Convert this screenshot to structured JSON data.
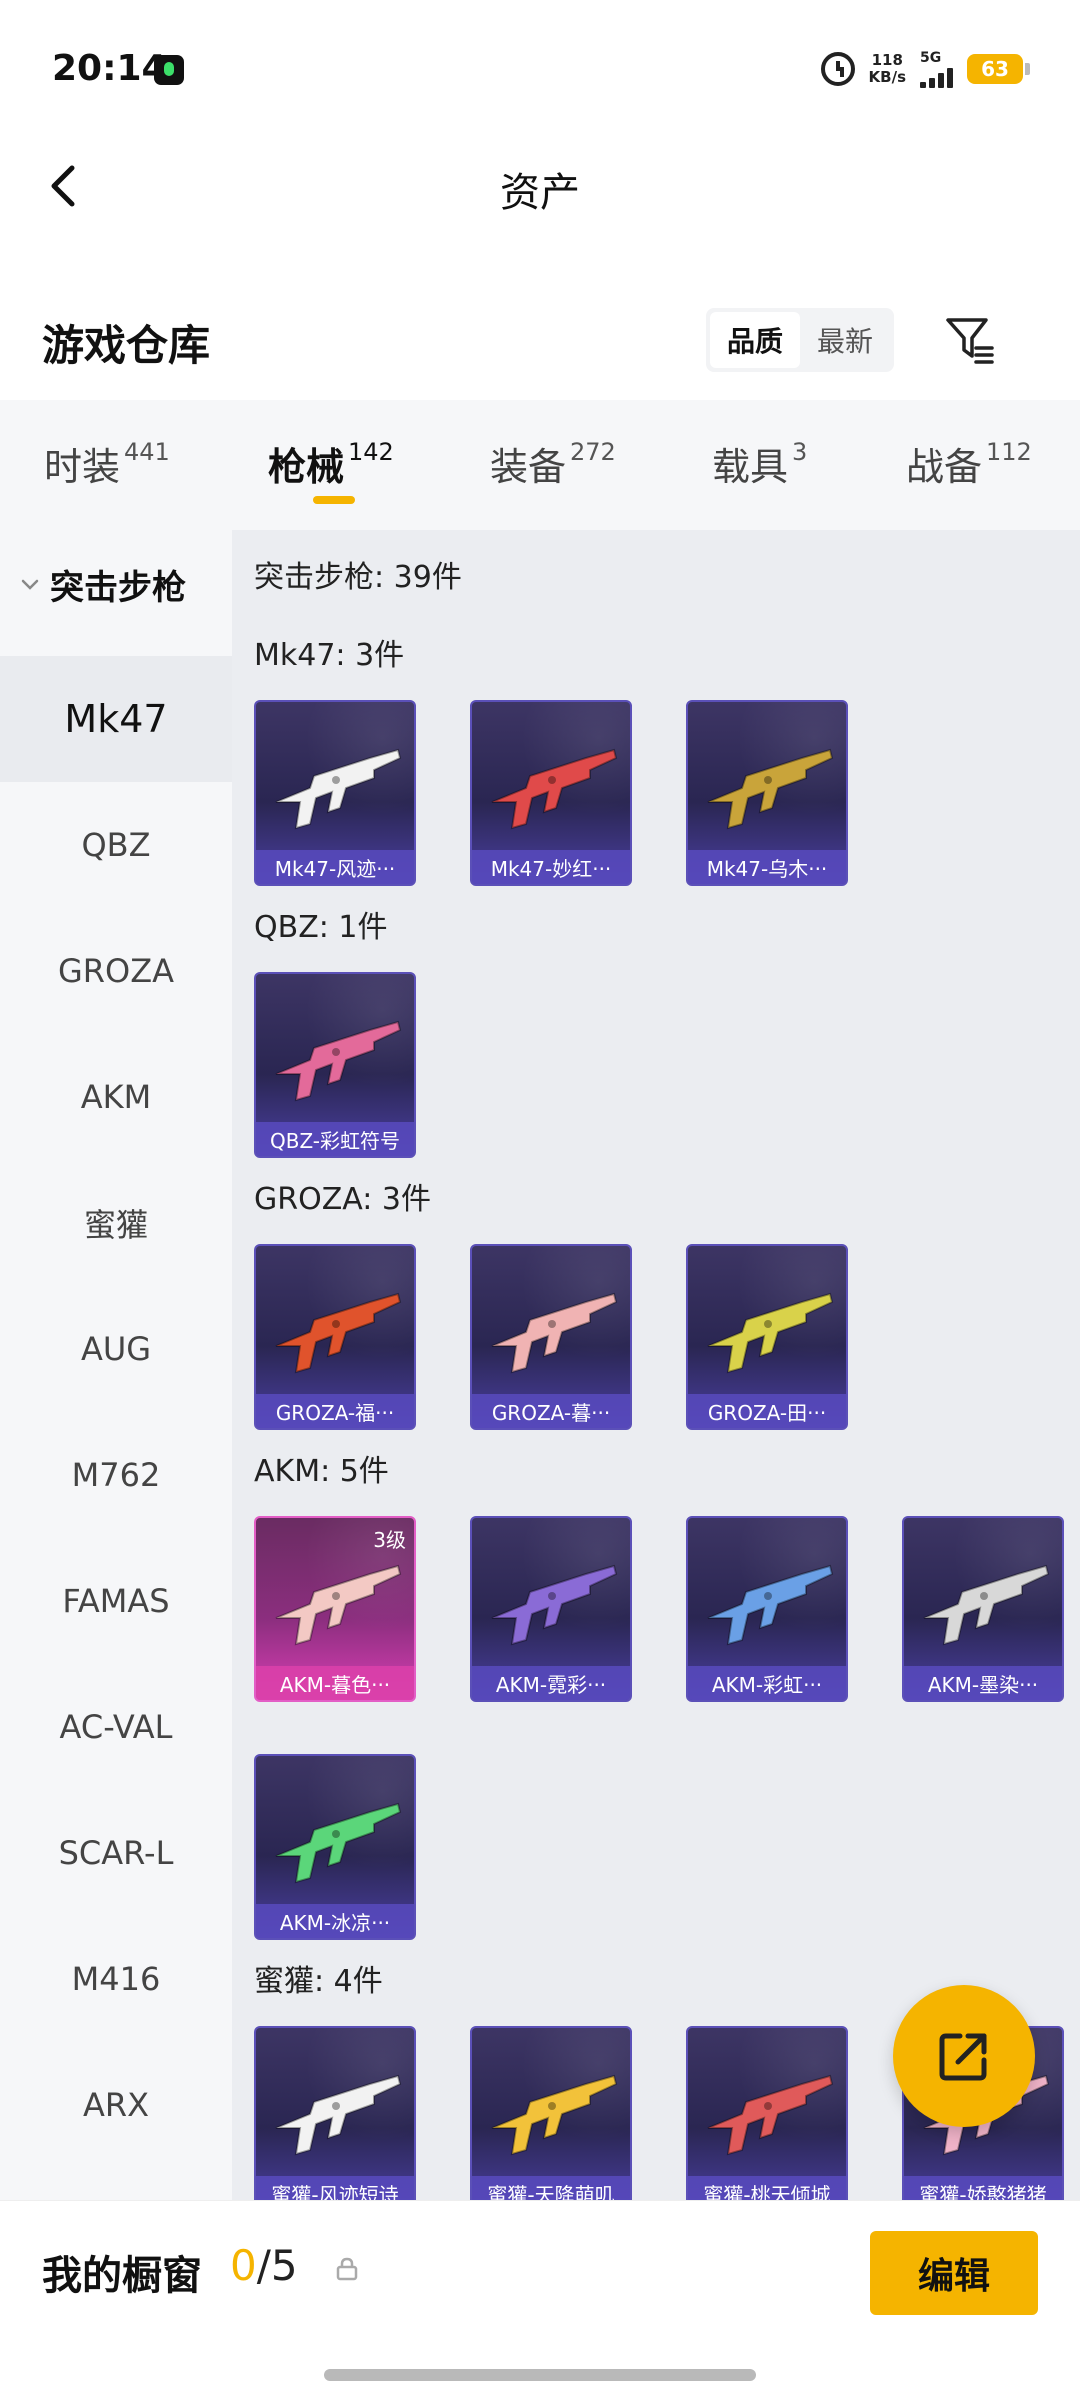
{
  "status_bar": {
    "time": "20:14",
    "net_speed_value": "118",
    "net_speed_unit": "KB/s",
    "network": "5G",
    "battery": "63"
  },
  "header": {
    "title": "资产",
    "back_icon": "chevron-left-icon"
  },
  "warehouse": {
    "title": "游戏仓库",
    "sort_options": [
      "品质",
      "最新"
    ],
    "sort_active": "品质",
    "filter_icon": "filter-icon"
  },
  "categories": [
    {
      "label": "时装",
      "count": "441"
    },
    {
      "label": "枪械",
      "count": "142",
      "active": true
    },
    {
      "label": "装备",
      "count": "272"
    },
    {
      "label": "载具",
      "count": "3"
    },
    {
      "label": "战备",
      "count": "112"
    }
  ],
  "sidebar": {
    "group_label": "突击步枪",
    "items": [
      "Mk47",
      "QBZ",
      "GROZA",
      "AKM",
      "蜜獾",
      "AUG",
      "M762",
      "FAMAS",
      "AC-VAL",
      "SCAR-L",
      "M416",
      "ARX"
    ],
    "active_item": "Mk47"
  },
  "content": {
    "group_summary": "突击步枪: 39件",
    "sections": [
      {
        "header": "Mk47: 3件",
        "cards": [
          {
            "label": "Mk47-风迹···",
            "color": "#f2f2f2"
          },
          {
            "label": "Mk47-妙红···",
            "color": "#e04a4a"
          },
          {
            "label": "Mk47-乌木···",
            "color": "#c9a43a"
          }
        ]
      },
      {
        "header": "QBZ: 1件",
        "cards": [
          {
            "label": "QBZ-彩虹符号",
            "color": "#e36a9a"
          }
        ]
      },
      {
        "header": "GROZA: 3件",
        "cards": [
          {
            "label": "GROZA-福···",
            "color": "#e0532c"
          },
          {
            "label": "GROZA-暮···",
            "color": "#f0b3b3"
          },
          {
            "label": "GROZA-田···",
            "color": "#d9d24a"
          }
        ]
      },
      {
        "header": "AKM: 5件",
        "cards": [
          {
            "label": "AKM-暮色···",
            "color": "#f3c9c4",
            "level": "3级",
            "highlight": true
          },
          {
            "label": "AKM-霓彩···",
            "color": "#8a6bd6"
          },
          {
            "label": "AKM-彩虹···",
            "color": "#6aa0e6"
          },
          {
            "label": "AKM-墨染···",
            "color": "#d8d8d8"
          },
          {
            "label": "AKM-冰凉···",
            "color": "#5bd67a"
          }
        ]
      },
      {
        "header": "蜜獾: 4件",
        "cards": [
          {
            "label": "蜜獾-风迹短诗",
            "color": "#f2f2f2"
          },
          {
            "label": "蜜獾-天降萌叽",
            "color": "#f2c23a"
          },
          {
            "label": "蜜獾-桃天倾城",
            "color": "#e05a5a"
          },
          {
            "label": "蜜獾-娇憨猪猪",
            "color": "#f0b3c8"
          }
        ]
      }
    ]
  },
  "bottom_bar": {
    "showcase_label": "我的橱窗",
    "showcase_current": "0",
    "showcase_total": "/5",
    "edit_label": "编辑"
  },
  "fab": {
    "icon": "share-out-icon",
    "color": "#f5b400"
  },
  "accent_color": "#f5b400"
}
